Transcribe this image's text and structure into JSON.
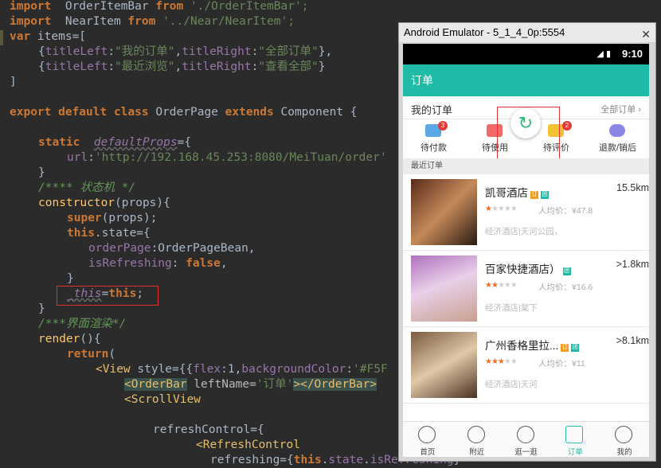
{
  "code": {
    "l1": [
      "import",
      "  OrderItemBar ",
      "from",
      " './OrderItemBar';"
    ],
    "l2": [
      "import",
      "  NearItem ",
      "from",
      " '../Near/NearItem';"
    ],
    "l3": [
      "var",
      " items=["
    ],
    "l4": [
      "{",
      "titleLeft",
      ":",
      "\"我的订单\"",
      ",",
      "titleRight",
      ":",
      "\"全部订单\"",
      "},"
    ],
    "l5": [
      "{",
      "titleLeft",
      ":",
      "\"最近浏览\"",
      ",",
      "titleRight",
      ":",
      "\"查看全部\"",
      "}"
    ],
    "l6": "]",
    "l8": [
      "export default class",
      " OrderPage ",
      "extends",
      " Component {"
    ],
    "l10": [
      "static",
      "  ",
      "defaultProps",
      "={"
    ],
    "l11": [
      "url",
      ":",
      "'http://192.168.45.253:8080/MeiTuan/order'"
    ],
    "l12": "}",
    "l13": "/**** 状态机 */",
    "l14": [
      "constructor",
      "(props){"
    ],
    "l15": [
      "super",
      "(props);"
    ],
    "l16": [
      "this",
      ".state={"
    ],
    "l17": [
      "orderPage",
      ":OrderPageBean,"
    ],
    "l18": [
      "isRefreshing",
      ": ",
      "false",
      ","
    ],
    "l19": "}",
    "l20": [
      "_this",
      "=",
      "this",
      ";"
    ],
    "l21": "}",
    "l22": "/***界面渲染*/",
    "l23": [
      "render",
      "(){"
    ],
    "l24": [
      "return",
      "("
    ],
    "l25": [
      "<View",
      " style={{",
      "flex",
      ":1,",
      "backgroundColor",
      ":",
      "'#F5F"
    ],
    "l26": [
      "<OrderBar",
      " leftName=",
      "'订单'",
      "></OrderBar>"
    ],
    "l27": [
      "<ScrollView"
    ],
    "l29": [
      "refreshControl={"
    ],
    "l30": [
      "<RefreshControl"
    ],
    "l31": [
      "refreshing={",
      "this",
      ".",
      "state",
      ".",
      "isRefreshing",
      "}"
    ]
  },
  "emulator": {
    "title": "Android Emulator - 5_1_4_0p:5554",
    "time": "9:10",
    "signal": "◢ ▮",
    "appbar_title": "订单",
    "my_orders": "我的订单",
    "all_orders": "全部订单",
    "status": [
      {
        "label": "待付款",
        "badge": "3",
        "color": "#5aa9e6"
      },
      {
        "label": "待使用",
        "badge": "",
        "color": "#f06a6a"
      },
      {
        "label": "待评价",
        "badge": "2",
        "color": "#f2c230"
      },
      {
        "label": "退款/销后",
        "badge": "",
        "color": "#8a86e6"
      }
    ],
    "refresh_glyph": "↻",
    "recent_label": "最近订单",
    "items": [
      {
        "name": "凯哥酒店",
        "tag1": "订",
        "tag2": "团",
        "dist": "15.5km",
        "stars_on": 1,
        "price": "人均价：¥47.8",
        "addr": "经济酒店|天河公园，"
      },
      {
        "name": "百家快捷酒店）",
        "tag1": "",
        "tag2": "团",
        "dist": ">1.8km",
        "stars_on": 2,
        "price": "人均价：¥16.6",
        "addr": "经济酒店|棠下"
      },
      {
        "name": "广州香格里拉...",
        "tag1": "订",
        "tag2": "团",
        "dist": ">8.1km",
        "stars_on": 3,
        "price": "人均价：¥11",
        "addr": "经济酒店|天河"
      }
    ],
    "tabs": [
      {
        "label": "首页",
        "icon": "home-icon"
      },
      {
        "label": "附近",
        "icon": "location-icon"
      },
      {
        "label": "逛一逛",
        "icon": "planet-icon"
      },
      {
        "label": "订单",
        "icon": "order-icon"
      },
      {
        "label": "我的",
        "icon": "user-icon"
      }
    ],
    "colors": {
      "accent": "#1fbba6",
      "tab_active": "#1fbba6",
      "star": "#f07020"
    }
  }
}
